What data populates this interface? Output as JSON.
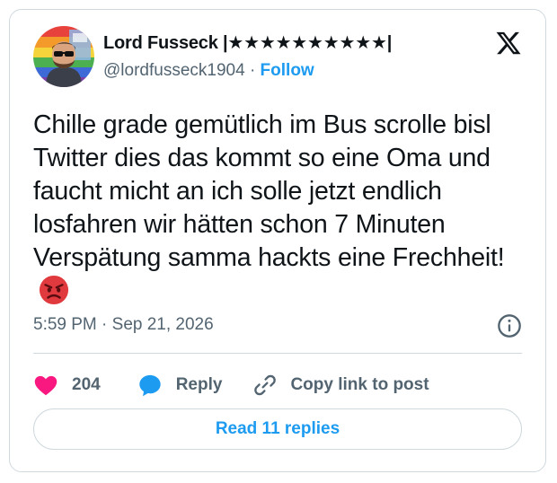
{
  "author": {
    "display_name": "Lord Fusseck |★★★★★★★★★★|",
    "handle": "@lordfusseck1904",
    "separator": "·",
    "follow_label": "Follow",
    "avatar_icon": "pride-avatar-icon"
  },
  "tweet": {
    "text": "Chille grade gemütlich im Bus scrolle bisl Twitter dies das kommt so eine Oma und faucht micht an ich solle jetzt endlich losfahren wir hätten schon 7 Minuten Verspätung samma hackts eine Frechheit!",
    "emoji": "angry-face-emoji",
    "timestamp": "5:59 PM · Sep 21, 2026"
  },
  "actions": {
    "like_count": "204",
    "reply_label": "Reply",
    "copy_link_label": "Copy link to post"
  },
  "read_replies_label": "Read 11 replies",
  "colors": {
    "accent": "#1d9bf0",
    "like": "#f91880",
    "secondary_text": "#536471",
    "border": "#cfd9de"
  }
}
